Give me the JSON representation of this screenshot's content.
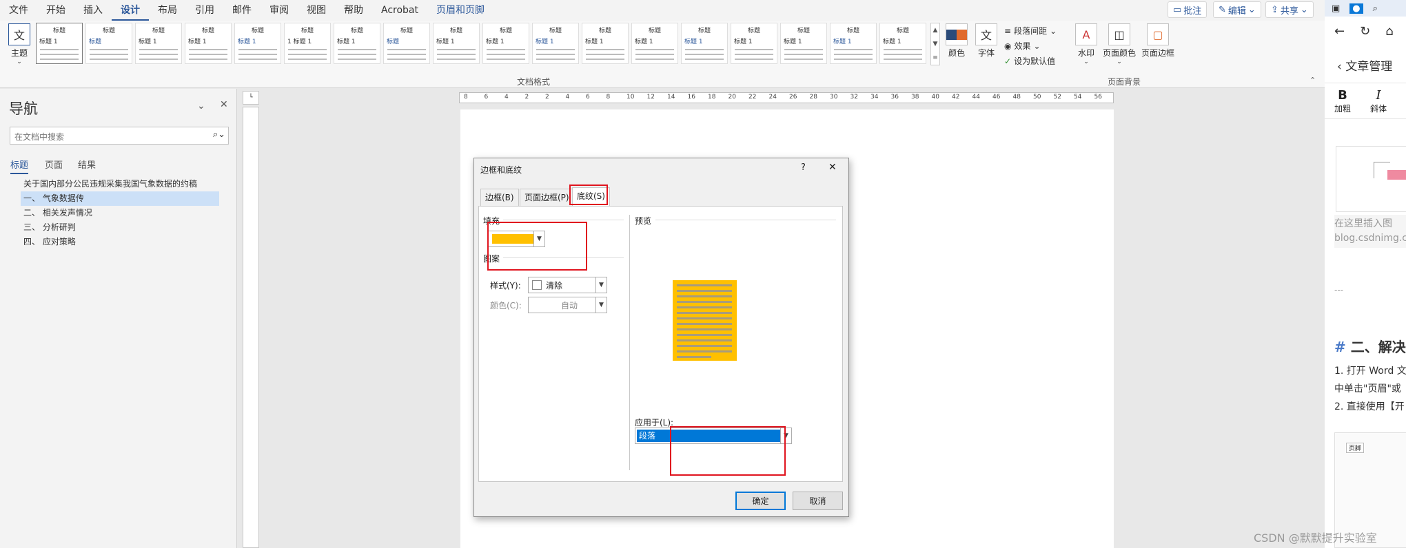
{
  "menu": {
    "items": [
      "文件",
      "开始",
      "插入",
      "设计",
      "布局",
      "引用",
      "邮件",
      "审阅",
      "视图",
      "帮助",
      "Acrobat",
      "页眉和页脚"
    ],
    "active": "设计",
    "context": "页眉和页脚",
    "comment": "批注",
    "edit": "编辑",
    "share": "共享"
  },
  "ribbon": {
    "theme": "主题",
    "doc_format_label": "文档格式",
    "style_gallery": [
      {
        "title": "标题",
        "sub": "标题 1"
      },
      {
        "title": "标题",
        "sub": "标题"
      },
      {
        "title": "标题",
        "sub": "标题 1"
      },
      {
        "title": "标题",
        "sub": "标题 1"
      },
      {
        "title": "标题",
        "sub": "标题 1"
      },
      {
        "title": "标题",
        "sub": "1 标题 1"
      },
      {
        "title": "标题",
        "sub": "标题 1"
      },
      {
        "title": "标题",
        "sub": "标题"
      },
      {
        "title": "标题",
        "sub": "标题 1"
      },
      {
        "title": "标题",
        "sub": "标题 1"
      },
      {
        "title": "标题",
        "sub": "标题 1"
      },
      {
        "title": "标题",
        "sub": "标题 1"
      },
      {
        "title": "标题",
        "sub": "标题 1"
      },
      {
        "title": "标题",
        "sub": "标题 1"
      },
      {
        "title": "标题",
        "sub": "标题 1"
      },
      {
        "title": "标题",
        "sub": "标题 1"
      },
      {
        "title": "标题",
        "sub": "标题 1"
      },
      {
        "title": "标题",
        "sub": "标题 1"
      }
    ],
    "colors": "颜色",
    "fonts": "字体",
    "paragraph_spacing": "段落间距",
    "effects": "效果",
    "set_default": "设为默认值",
    "watermark": "水印",
    "page_color": "页面颜色",
    "page_borders": "页面边框",
    "page_bg_label": "页面背景"
  },
  "nav": {
    "title": "导航",
    "search_placeholder": "在文档中搜索",
    "tabs": [
      "标题",
      "页面",
      "结果"
    ],
    "headings": [
      "关于国内部分公民违规采集我国气象数据的约稿",
      "一、 气象数据传",
      "二、 相关发声情况",
      "三、 分析研判",
      "四、 应对策略"
    ]
  },
  "ruler": {
    "ticks": [
      "8",
      "6",
      "4",
      "2",
      "2",
      "4",
      "6",
      "8",
      "10",
      "12",
      "14",
      "16",
      "18",
      "20",
      "22",
      "24",
      "26",
      "28",
      "30",
      "32",
      "34",
      "36",
      "38",
      "40",
      "42",
      "44",
      "46",
      "48",
      "50",
      "52",
      "54",
      "56"
    ]
  },
  "dialog": {
    "title": "边框和底纹",
    "help": "?",
    "close": "✕",
    "tabs": [
      "边框(B)",
      "页面边框(P)",
      "底纹(S)"
    ],
    "fill_label": "填充",
    "fill_color": "#ffc000",
    "pattern_label": "图案",
    "style_label": "样式(Y):",
    "style_value": "清除",
    "color_label": "颜色(C):",
    "color_value": "自动",
    "preview_label": "预览",
    "apply_label": "应用于(L):",
    "apply_value": "段落",
    "ok": "确定",
    "cancel": "取消"
  },
  "browser": {
    "back_title": "文章管理",
    "bold": "B",
    "bold_label": "加粗",
    "italic": "I",
    "italic_label": "斜体",
    "img_hint": "在这里插入图",
    "img_url": "blog.csdnimg.c",
    "dashes": "---",
    "hash": "#",
    "heading": "二、解决",
    "line1": "1. 打开 Word 文",
    "line2": "中单击\"页眉\"或",
    "line3": "2. 直接使用【开",
    "thumb_label": "页脚"
  },
  "watermark": "CSDN @默默提升实验室"
}
